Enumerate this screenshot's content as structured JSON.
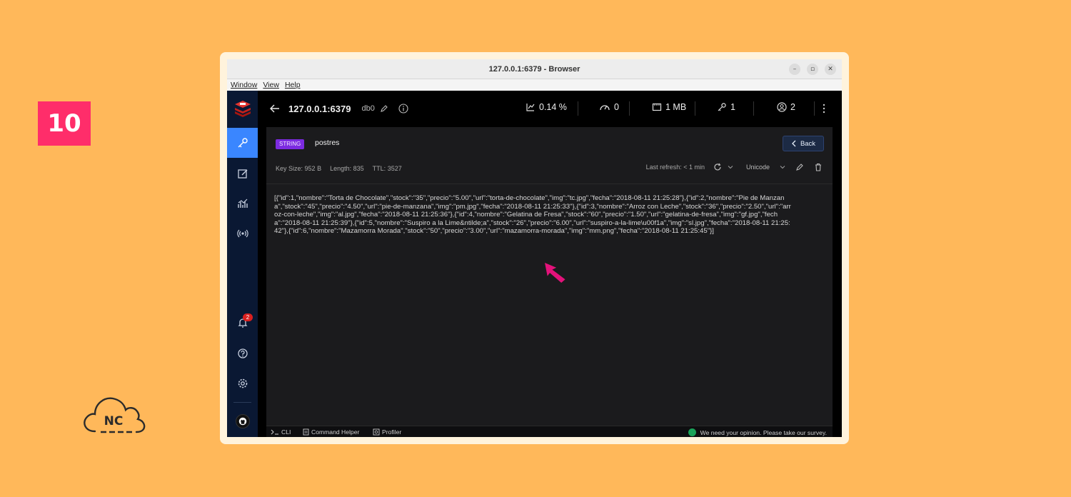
{
  "step_number": "10",
  "brand_logo_text": "NC",
  "window": {
    "title": "127.0.0.1:6379 - Browser",
    "menu": [
      "Window",
      "View",
      "Help"
    ]
  },
  "topbar": {
    "host": "127.0.0.1:6379",
    "db": "db0",
    "cpu": "0.14 %",
    "ops": "0",
    "memory": "1 MB",
    "keys": "1",
    "clients": "2"
  },
  "sidebar": {
    "notifications_count": "2"
  },
  "key": {
    "type": "STRING",
    "name": "postres",
    "back_label": "Back",
    "key_size_label": "Key Size:",
    "key_size": "952 B",
    "length_label": "Length:",
    "length": "835",
    "ttl_label": "TTL:",
    "ttl": "3527",
    "last_refresh": "Last refresh: < 1 min",
    "format": "Unicode",
    "value": "[{\"id\":1,\"nombre\":\"Torta de Chocolate\",\"stock\":\"35\",\"precio\":\"5.00\",\"url\":\"torta-de-chocolate\",\"img\":\"tc.jpg\",\"fecha\":\"2018-08-11 21:25:28\"},{\"id\":2,\"nombre\":\"Pie de Manzana\",\"stock\":\"45\",\"precio\":\"4.50\",\"url\":\"pie-de-manzana\",\"img\":\"pm.jpg\",\"fecha\":\"2018-08-11 21:25:33\"},{\"id\":3,\"nombre\":\"Arroz con Leche\",\"stock\":\"36\",\"precio\":\"2.50\",\"url\":\"arroz-con-leche\",\"img\":\"al.jpg\",\"fecha\":\"2018-08-11 21:25:36\"},{\"id\":4,\"nombre\":\"Gelatina de Fresa\",\"stock\":\"60\",\"precio\":\"1.50\",\"url\":\"gelatina-de-fresa\",\"img\":\"gf.jpg\",\"fecha\":\"2018-08-11 21:25:39\"},{\"id\":5,\"nombre\":\"Suspiro a la Lime&ntilde;a\",\"stock\":\"26\",\"precio\":\"6.00\",\"url\":\"suspiro-a-la-lime\\u00f1a\",\"img\":\"sl.jpg\",\"fecha\":\"2018-08-11 21:25:42\"},{\"id\":6,\"nombre\":\"Mazamorra Morada\",\"stock\":\"50\",\"precio\":\"3.00\",\"url\":\"mazamorra-morada\",\"img\":\"mm.png\",\"fecha\":\"2018-08-11 21:25:45\"}]"
  },
  "footer": {
    "cli": "CLI",
    "command_helper": "Command Helper",
    "profiler": "Profiler",
    "survey": "We need your opinion. Please take our survey."
  },
  "colors": {
    "background": "#FFB85A",
    "step_badge": "#FF2D6A",
    "accent": "#3A86FF",
    "type_badge": "#7C2BE0",
    "cursor": "#E3127A"
  }
}
